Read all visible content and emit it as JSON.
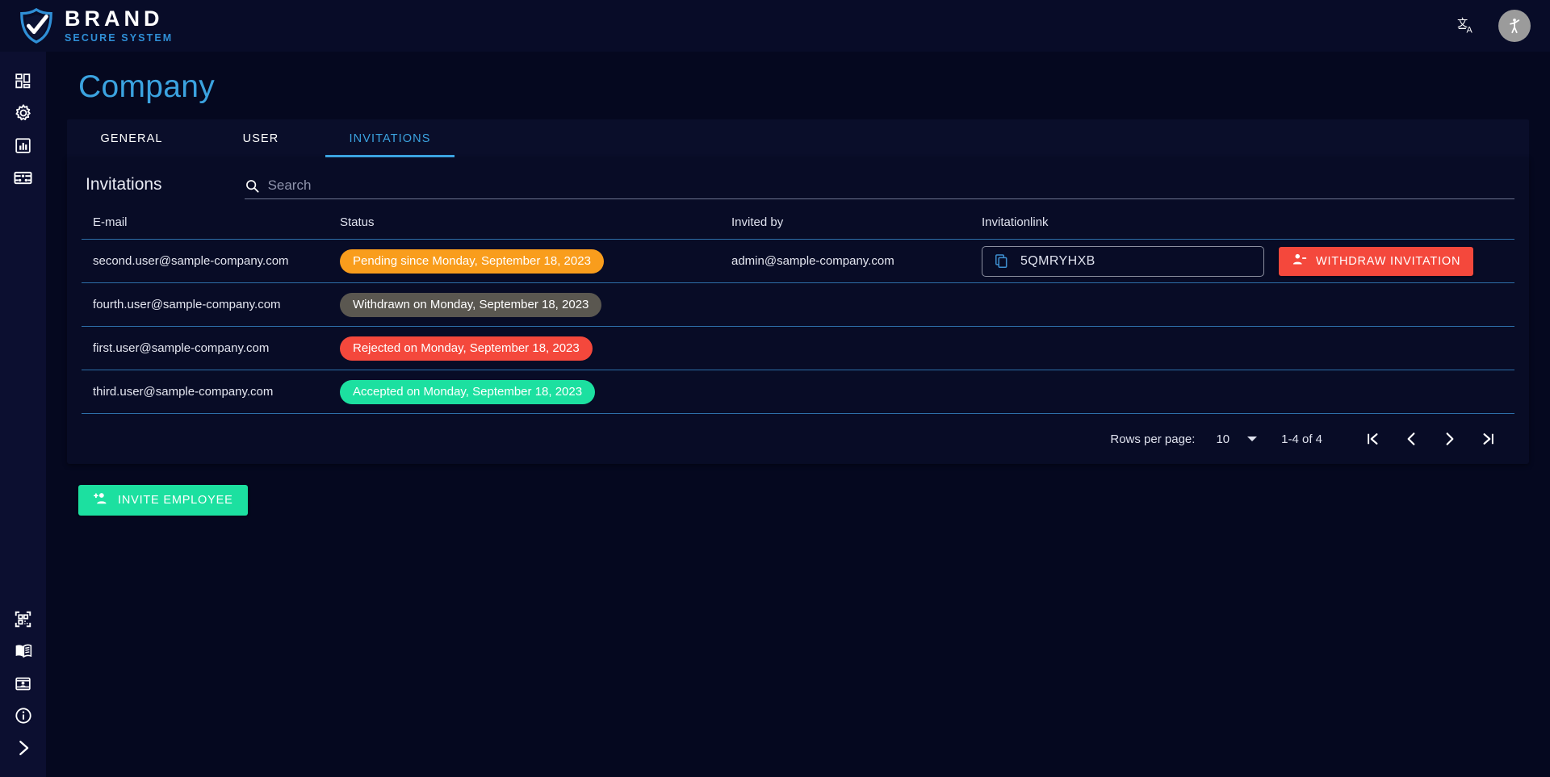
{
  "topbar": {
    "brand_name": "BRAND",
    "brand_sub": "SECURE SYSTEM",
    "brand_logo_icon": "shield-check-icon",
    "language_icon": "translate-icon",
    "accessibility_icon": "accessibility-icon"
  },
  "sidebar": {
    "top_items": [
      {
        "icon": "dashboard-grid-icon",
        "name": "sidebar-item-dashboard"
      },
      {
        "icon": "gear-icon",
        "name": "sidebar-item-settings"
      },
      {
        "icon": "bar-chart-icon",
        "name": "sidebar-item-statistics"
      },
      {
        "icon": "network-nodes-icon",
        "name": "sidebar-item-network"
      }
    ],
    "bottom_items": [
      {
        "icon": "qr-code-icon",
        "name": "sidebar-item-qrcode"
      },
      {
        "icon": "book-icon",
        "name": "sidebar-item-manual"
      },
      {
        "icon": "id-card-icon",
        "name": "sidebar-item-contacts"
      },
      {
        "icon": "info-circle-icon",
        "name": "sidebar-item-info"
      },
      {
        "icon": "chevron-right-icon",
        "name": "sidebar-expand-toggle"
      }
    ]
  },
  "page": {
    "title": "Company"
  },
  "tabs": [
    {
      "label": "GENERAL",
      "active": false
    },
    {
      "label": "USER",
      "active": false
    },
    {
      "label": "INVITATIONS",
      "active": true
    }
  ],
  "card": {
    "title": "Invitations",
    "search": {
      "placeholder": "Search",
      "value": "",
      "icon": "search-icon"
    }
  },
  "table": {
    "headers": {
      "email": "E-mail",
      "status": "Status",
      "invited_by": "Invited by",
      "invitation_link": "Invitationlink"
    },
    "rows": [
      {
        "email": "second.user@sample-company.com",
        "status": "Pending since Monday, September 18, 2023",
        "status_type": "pending",
        "invited_by": "admin@sample-company.com",
        "link_code": "5QMRYHXB",
        "action_label": "WITHDRAW INVITATION",
        "has_action": true
      },
      {
        "email": "fourth.user@sample-company.com",
        "status": "Withdrawn on Monday, September 18, 2023",
        "status_type": "withdrawn",
        "invited_by": "",
        "link_code": "",
        "action_label": "",
        "has_action": false
      },
      {
        "email": "first.user@sample-company.com",
        "status": "Rejected on Monday, September 18, 2023",
        "status_type": "rejected",
        "invited_by": "",
        "link_code": "",
        "action_label": "",
        "has_action": false
      },
      {
        "email": "third.user@sample-company.com",
        "status": "Accepted on Monday, September 18, 2023",
        "status_type": "accepted",
        "invited_by": "",
        "link_code": "",
        "action_label": "",
        "has_action": false
      }
    ]
  },
  "paginator": {
    "rows_per_page_label": "Rows per page:",
    "rows_per_page_value": "10",
    "range_label": "1-4 of 4",
    "first_page_icon": "first-page-icon",
    "prev_page_icon": "previous-page-icon",
    "next_page_icon": "next-page-icon",
    "last_page_icon": "last-page-icon"
  },
  "actions": {
    "invite_label": "INVITE EMPLOYEE",
    "invite_icon": "person-add-icon",
    "withdraw_icon": "person-remove-icon",
    "copy_icon": "copy-icon"
  },
  "colors": {
    "accent_blue": "#3ba3e0",
    "pending_orange": "#f99d1c",
    "withdrawn_gray": "#5a5750",
    "rejected_red": "#f4483c",
    "accepted_green": "#1ce0a0",
    "background": "#05081f",
    "panel": "#080c26",
    "sidebar": "#0c0f30"
  }
}
